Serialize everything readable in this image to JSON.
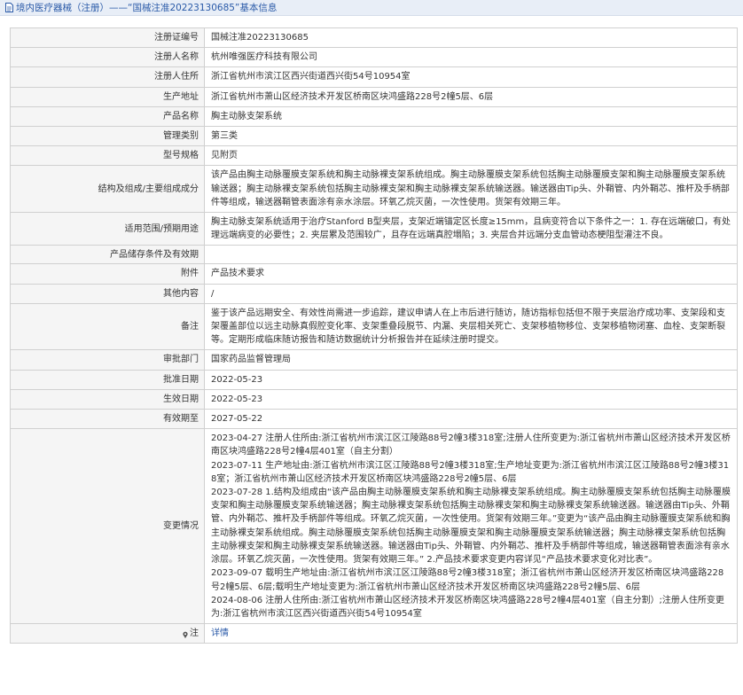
{
  "header": {
    "title": "境内医疗器械（注册）——“国械注准20223130685”基本信息"
  },
  "rows": [
    {
      "label": "注册证编号",
      "value": "国械注准20223130685"
    },
    {
      "label": "注册人名称",
      "value": "杭州唯强医疗科技有限公司"
    },
    {
      "label": "注册人住所",
      "value": "浙江省杭州市滨江区西兴街道西兴街54号10954室"
    },
    {
      "label": "生产地址",
      "value": "浙江省杭州市萧山区经济技术开发区桥南区块鸿盛路228号2幢5层、6层"
    },
    {
      "label": "产品名称",
      "value": "胸主动脉支架系统"
    },
    {
      "label": "管理类别",
      "value": "第三类"
    },
    {
      "label": "型号规格",
      "value": "见附页"
    },
    {
      "label": "结构及组成/主要组成成分",
      "value": "该产品由胸主动脉覆膜支架系统和胸主动脉裸支架系统组成。胸主动脉覆膜支架系统包括胸主动脉覆膜支架和胸主动脉覆膜支架系统输送器；胸主动脉裸支架系统包括胸主动脉裸支架和胸主动脉裸支架系统输送器。输送器由Tip头、外鞘管、内外鞘芯、推杆及手柄部件等组成，输送器鞘管表面涂有亲水涂层。环氧乙烷灭菌，一次性使用。货架有效期三年。"
    },
    {
      "label": "适用范围/预期用途",
      "value": "胸主动脉支架系统适用于治疗Stanford B型夹层，支架近端锚定区长度≥15mm，且病变符合以下条件之一：1. 存在远端破口，有处理远端病变的必要性；2. 夹层累及范围较广，且存在远端真腔塌陷；3. 夹层合并远端分支血管动态梗阻型灌注不良。"
    },
    {
      "label": "产品储存条件及有效期",
      "value": ""
    },
    {
      "label": "附件",
      "value": "产品技术要求"
    },
    {
      "label": "其他内容",
      "value": "/"
    },
    {
      "label": "备注",
      "value": "鉴于该产品远期安全、有效性尚需进一步追踪，建议申请人在上市后进行随访，随访指标包括但不限于夹层治疗成功率、支架段和支架覆盖部位以远主动脉真假腔变化率、支架重叠段脱节、内漏、夹层相关死亡、支架移植物移位、支架移植物闭塞、血栓、支架断裂等。定期形成临床随访报告和随访数据统计分析报告并在延续注册时提交。"
    },
    {
      "label": "审批部门",
      "value": "国家药品监督管理局"
    },
    {
      "label": "批准日期",
      "value": "2022-05-23"
    },
    {
      "label": "生效日期",
      "value": "2022-05-23"
    },
    {
      "label": "有效期至",
      "value": "2027-05-22"
    }
  ],
  "changes": {
    "label": "变更情况",
    "items": [
      "2023-04-27 注册人住所由:浙江省杭州市滨江区江陵路88号2幢3楼318室;注册人住所变更为:浙江省杭州市萧山区经济技术开发区桥南区块鸿盛路228号2幢4层401室（自主分割）",
      "2023-07-11 生产地址由:浙江省杭州市滨江区江陵路88号2幢3楼318室;生产地址变更为:浙江省杭州市滨江区江陵路88号2幢3楼318室；浙江省杭州市萧山区经济技术开发区桥南区块鸿盛路228号2幢5层、6层",
      "2023-07-28 1.结构及组成由“该产品由胸主动脉覆膜支架系统和胸主动脉裸支架系统组成。胸主动脉覆膜支架系统包括胸主动脉覆膜支架和胸主动脉覆膜支架系统输送器；胸主动脉裸支架系统包括胸主动脉裸支架和胸主动脉裸支架系统输送器。输送器由Tip头、外鞘管、内外鞘芯、推杆及手柄部件等组成。环氧乙烷灭菌，一次性使用。货架有效期三年。”变更为“该产品由胸主动脉覆膜支架系统和胸主动脉裸支架系统组成。胸主动脉覆膜支架系统包括胸主动脉覆膜支架和胸主动脉覆膜支架系统输送器；胸主动脉裸支架系统包括胸主动脉裸支架和胸主动脉裸支架系统输送器。输送器由Tip头、外鞘管、内外鞘芯、推杆及手柄部件等组成，输送器鞘管表面涂有亲水涂层。环氧乙烷灭菌，一次性使用。货架有效期三年。” 2.产品技术要求变更内容详见“产品技术要求变化对比表”。",
      "2023-09-07 载明生产地址由:浙江省杭州市滨江区江陵路88号2幢3楼318室；浙江省杭州市萧山区经济开发区桥南区块鸿盛路228号2幢5层、6层;载明生产地址变更为:浙江省杭州市萧山区经济技术开发区桥南区块鸿盛路228号2幢5层、6层",
      "2024-08-06 注册人住所由:浙江省杭州市萧山区经济技术开发区桥南区块鸿盛路228号2幢4层401室（自主分割）;注册人住所变更为:浙江省杭州市滨江区西兴街道西兴街54号10954室"
    ]
  },
  "footer": {
    "label": "注",
    "link": "详情"
  }
}
